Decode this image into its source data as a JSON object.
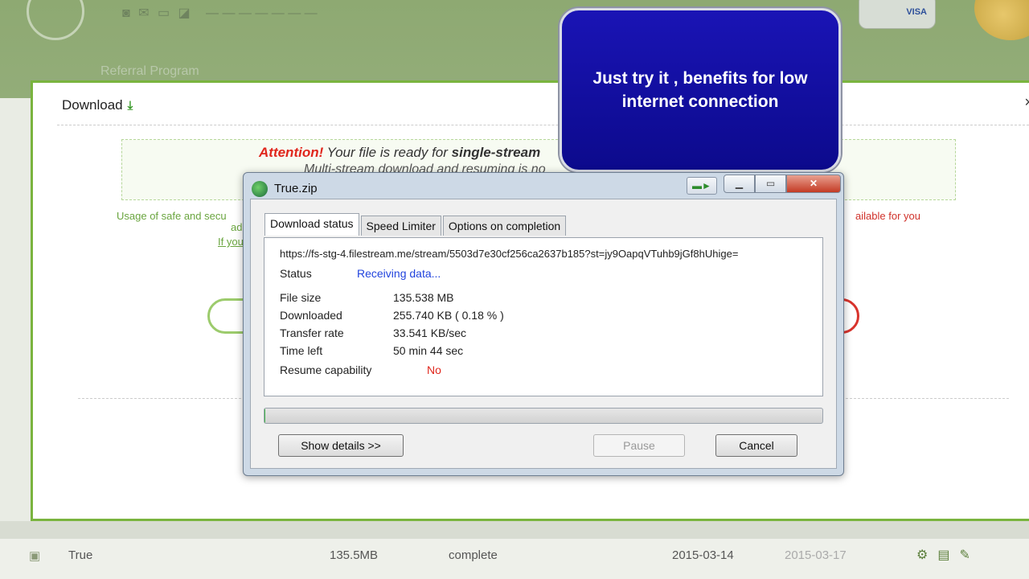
{
  "site": {
    "referral": "Referral Program",
    "visa": "VISA",
    "download_title": "Download",
    "close": "×",
    "attention_label": "Attention!",
    "attention_text": " Your file is ready for ",
    "attention_bold": "single-stream",
    "attention_line2": "Multi-stream download and resuming is no",
    "usage_text": "Usage of safe and secu",
    "usage_small": "ad",
    "usage_right": "ailable for you",
    "if_link": "If you"
  },
  "table_row": {
    "name": "True",
    "size": "135.5MB",
    "status": "complete",
    "date1": "2015-03-14",
    "date2": "2015-03-17"
  },
  "callout": {
    "text": "Just try it , benefits for low internet connection"
  },
  "dialog": {
    "title": "True.zip",
    "tabs": [
      "Download status",
      "Speed Limiter",
      "Options on completion"
    ],
    "active_tab": "Download status",
    "url": "https://fs-stg-4.filestream.me/stream/5503d7e30cf256ca2637b185?st=jy9OapqVTuhb9jGf8hUhige=",
    "status_label": "Status",
    "status_value": "Receiving data...",
    "file_size_label": "File size",
    "file_size_value": "135.538  MB",
    "downloaded_label": "Downloaded",
    "downloaded_value": "255.740  KB  ( 0.18 % )",
    "transfer_rate_label": "Transfer rate",
    "transfer_rate_value": "33.541  KB/sec",
    "time_left_label": "Time left",
    "time_left_value": "50 min 44 sec",
    "resume_label": "Resume capability",
    "resume_value": "No",
    "progress_percent": 0.18,
    "show_details": "Show details >>",
    "pause": "Pause",
    "cancel": "Cancel"
  },
  "colors": {
    "callout_bg": "#1208a8",
    "site_green": "#7ab43f",
    "attention_red": "#e0261c",
    "status_blue": "#2244dd"
  },
  "icons": [
    "download-icon",
    "app-globe-icon",
    "minimize-icon",
    "maximize-icon",
    "close-icon",
    "mouse-cursor-icon"
  ]
}
